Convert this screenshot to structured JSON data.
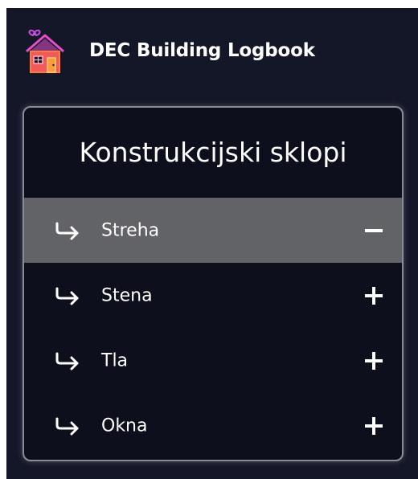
{
  "app": {
    "title": "DEC Building Logbook",
    "logo_icon": "house-icon",
    "background_color": "#141728"
  },
  "panel": {
    "title": "Konstrukcijski sklopi",
    "border_color": "#8a8c96",
    "background_color": "#0d0f1c",
    "items": [
      {
        "label": "Streha",
        "expanded": true,
        "arrow_icon": "return-arrow-icon",
        "toggle_icon": "minus-icon"
      },
      {
        "label": "Stena",
        "expanded": false,
        "arrow_icon": "return-arrow-icon",
        "toggle_icon": "plus-icon"
      },
      {
        "label": "Tla",
        "expanded": false,
        "arrow_icon": "return-arrow-icon",
        "toggle_icon": "plus-icon"
      },
      {
        "label": "Okna",
        "expanded": false,
        "arrow_icon": "return-arrow-icon",
        "toggle_icon": "plus-icon"
      }
    ],
    "active_item_color": "#626367"
  }
}
